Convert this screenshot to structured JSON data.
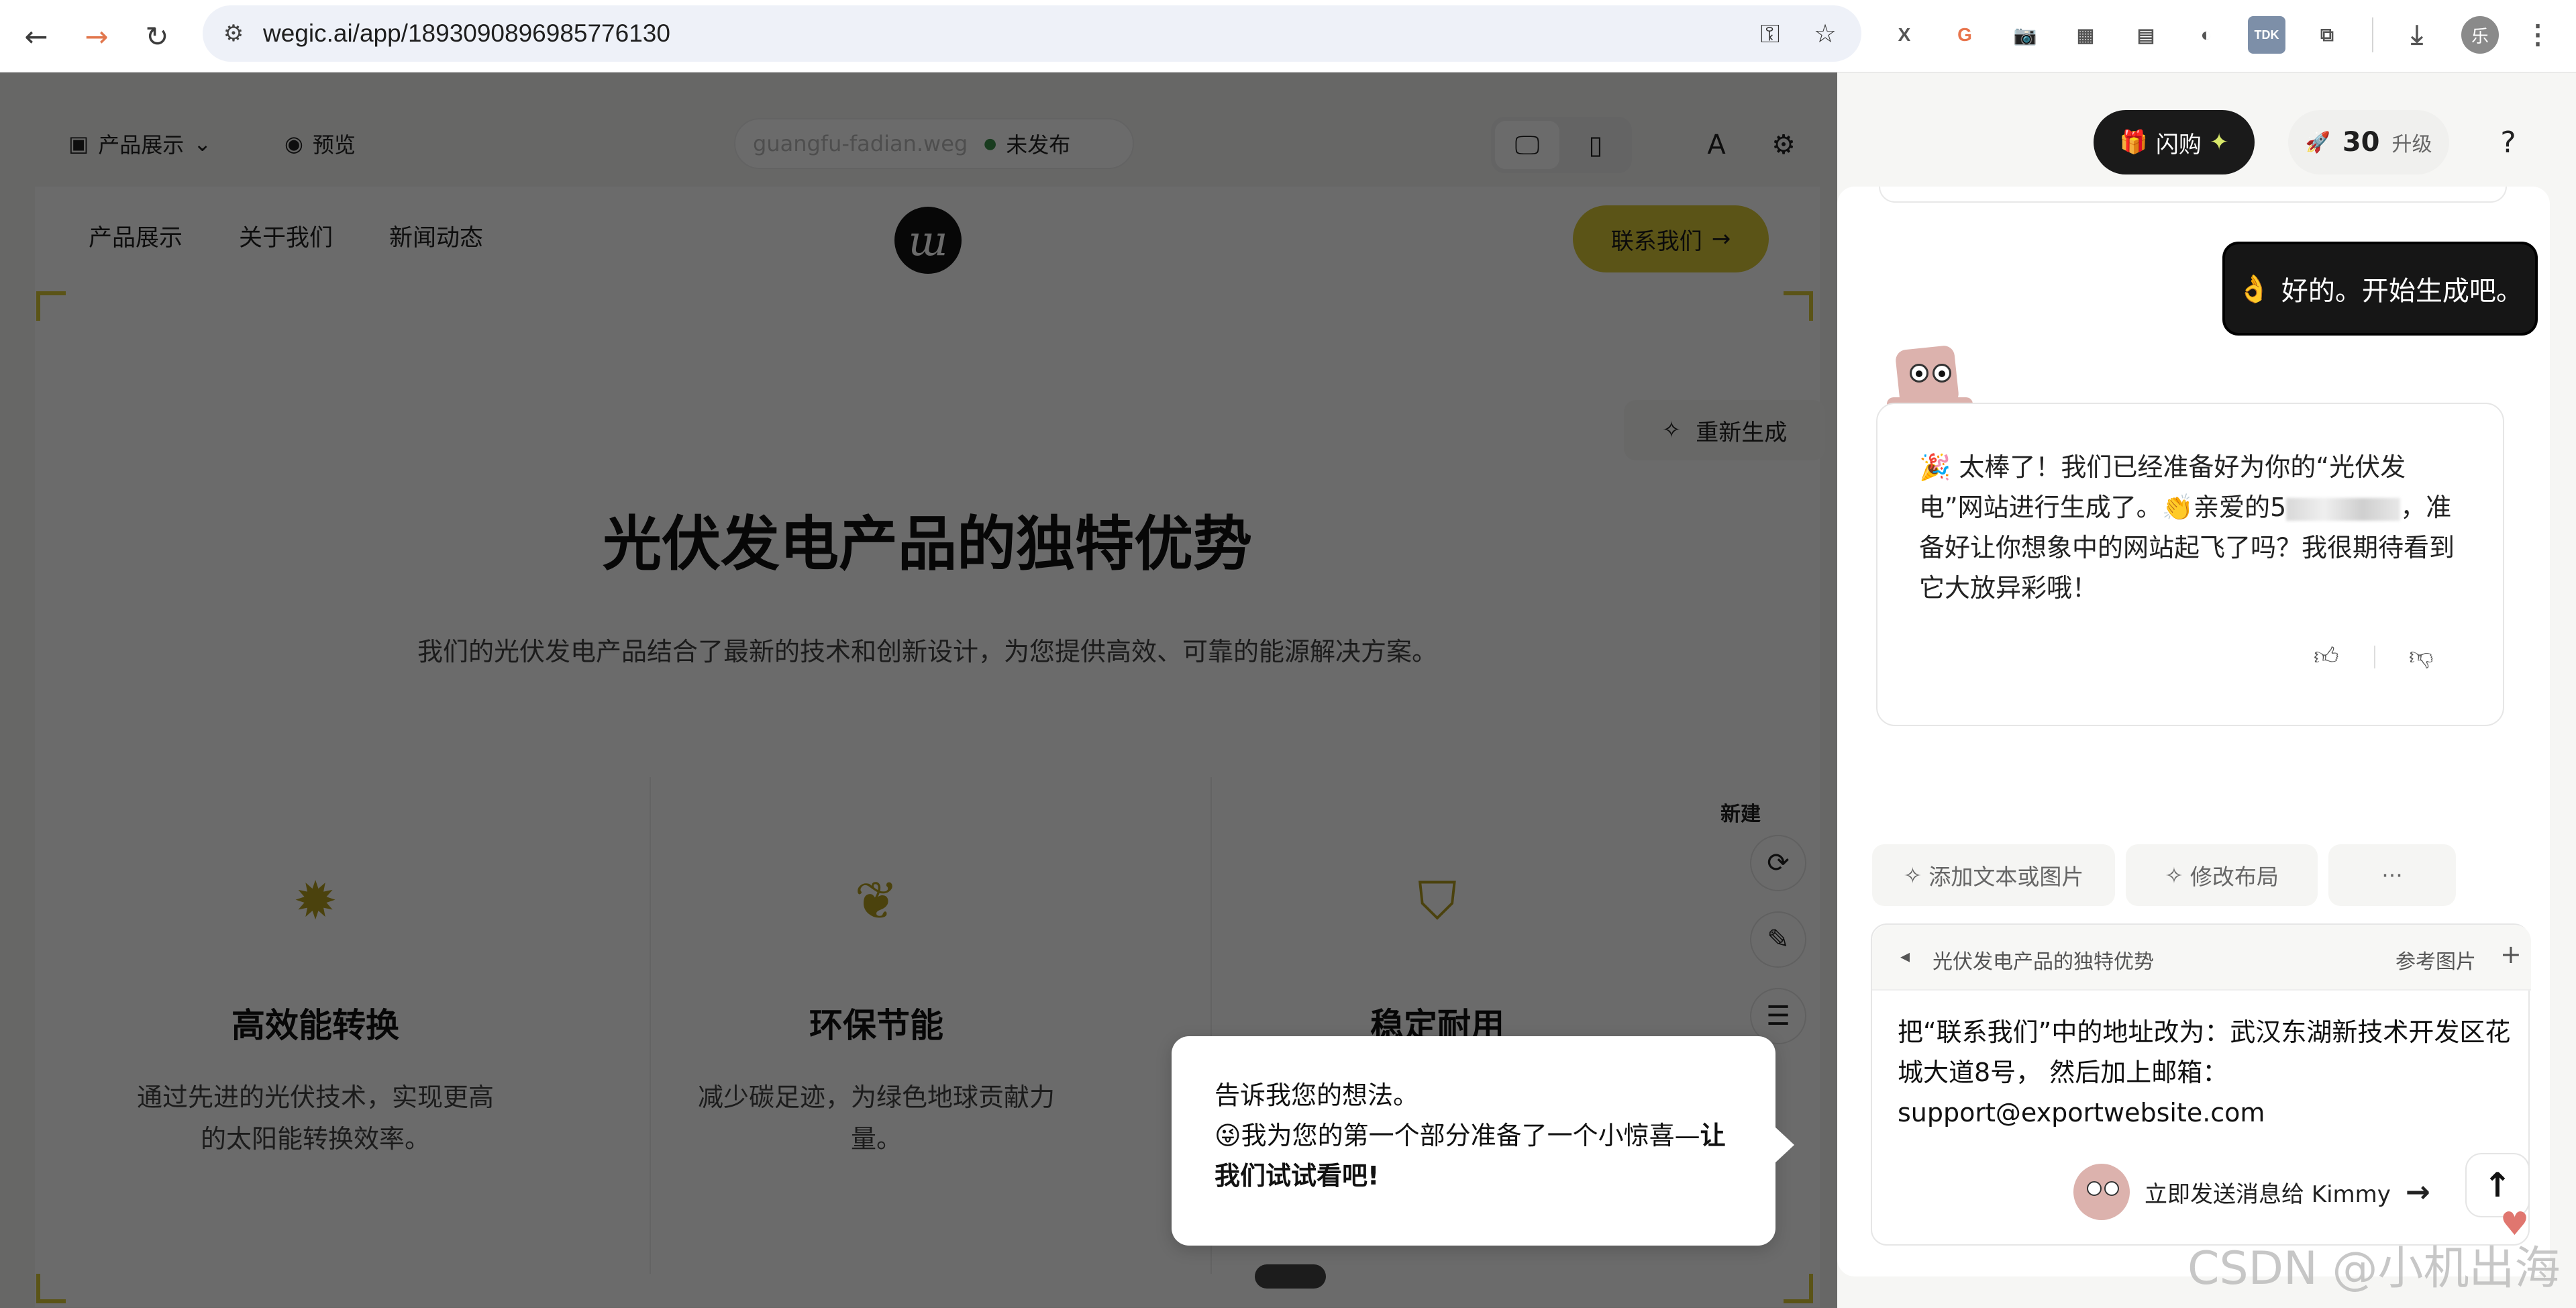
{
  "browser": {
    "url": "wegic.ai/app/1893090896985776130",
    "profile_initial": "乐",
    "extensions": [
      "X",
      "G",
      "📷",
      "▦",
      "▤",
      "◐",
      "TDK",
      "⧉"
    ]
  },
  "toolbar": {
    "page_selector": "产品展示",
    "preview": "预览",
    "domain": "guangfu-fadian.weg",
    "publish_status": "未发布",
    "flash_label": "闪购",
    "credits": "30",
    "upgrade": "升级",
    "help": "?"
  },
  "site": {
    "nav": [
      "产品展示",
      "关于我们",
      "新闻动态"
    ],
    "logo_letter": "ա",
    "contact_button": "联系我们",
    "regenerate": "重新生成",
    "hero_title": "光伏发电产品的独特优势",
    "hero_desc": "我们的光伏发电产品结合了最新的技术和创新设计，为您提供高效、可靠的能源解决方案。",
    "features": [
      {
        "icon": "sun-icon",
        "title": "高效能转换",
        "desc": "通过先进的光伏技术，实现更高的太阳能转换效率。"
      },
      {
        "icon": "leaf-icon",
        "title": "环保节能",
        "desc": "减少碳足迹，为绿色地球贡献力量。"
      },
      {
        "icon": "shield-icon",
        "title": "稳定耐用",
        "desc": ""
      }
    ],
    "new_badge": "新建"
  },
  "tooltip": {
    "line1": "告诉我您的想法。",
    "line2a": "😜我为您的第一个部分准备了一个小惊喜—",
    "line2b": "让我们试试看吧!"
  },
  "chat": {
    "user_message": "好的。开始生成吧。",
    "bot_message_a": "🎉 太棒了！我们已经准备好为你的“光伏发电”网站进行生成了。👏亲爱的5",
    "bot_message_b": "，准备好让你想象中的网站起飞了吗？我很期待看到它大放异彩哦！",
    "quick_actions": [
      "添加文本或图片",
      "修改布局",
      "···"
    ],
    "context_title": "光伏发电产品的独特优势",
    "reference_image": "参考图片",
    "input_text": "把“联系我们”中的地址改为：武汉东湖新技术开发区花城大道8号， 然后加上邮箱：support@exportwebsite.com",
    "send_label": "立即发送消息给 Kimmy"
  },
  "watermark": "CSDN @小机出海"
}
